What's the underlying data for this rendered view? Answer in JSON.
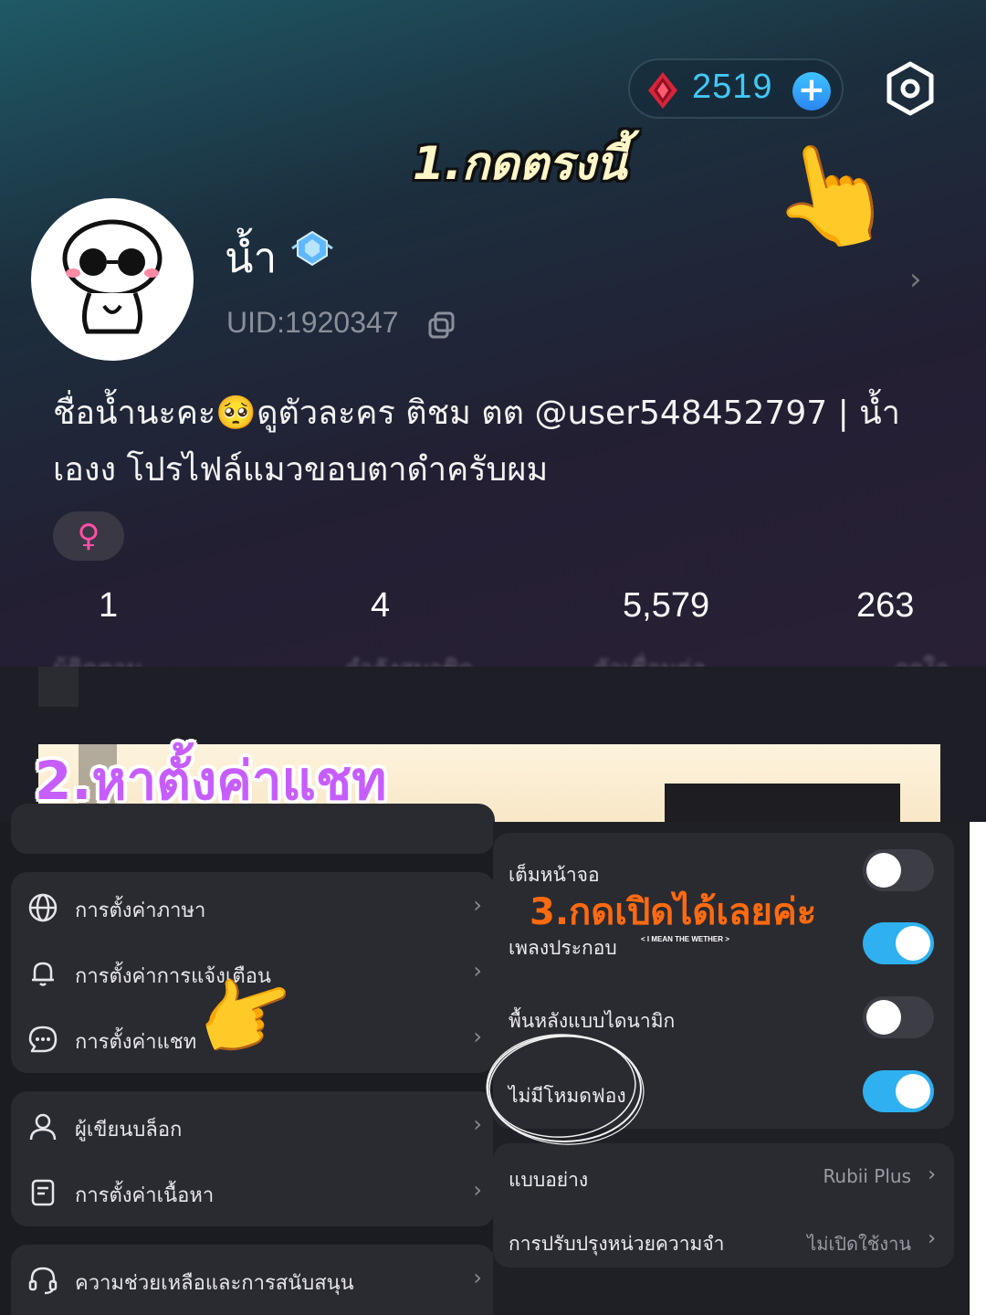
{
  "header": {
    "gem_count": "2519",
    "gem_plus": "+",
    "gem_icon": "diamond-gem-icon",
    "settings_icon": "hexagon-settings-icon"
  },
  "annotations": {
    "step1": "1.กดตรงนี้",
    "step2": "2.หาตั้งค่าแชท",
    "step3": "3.กดเปิดได้เลยค่ะ",
    "tiny_note": "< I MEAN THE WETHER >",
    "hand_emoji": "👉"
  },
  "profile": {
    "name": "น้ำ",
    "uid": "UID:1920347",
    "bio": "ชื่อน้ำนะคะ🥺ดูตัวละคร ติชม ตต @user548452797 | น้ำ เองง โปรไฟล์แมวขอบตาดำครับผม",
    "gender_symbol": "♀",
    "stats": [
      "1",
      "4",
      "5,579",
      "263"
    ],
    "stat_labels": [
      "ผู้ติดตาม",
      "กำลังสมาชิก",
      "ตัวเชื่อมต่อ",
      "ถูกใจ"
    ]
  },
  "left_menu": {
    "card1": [
      {
        "label": "การตั้งค่าภาษา",
        "icon": "globe-icon"
      },
      {
        "label": "การตั้งค่าการแจ้งเตือน",
        "icon": "bell-icon"
      },
      {
        "label": "การตั้งค่าแชท",
        "icon": "chat-bubble-icon"
      }
    ],
    "card2": [
      {
        "label": "ผู้เขียนบล็อก",
        "icon": "person-icon"
      },
      {
        "label": "การตั้งค่าเนื้อหา",
        "icon": "document-icon"
      }
    ],
    "card3": [
      {
        "label": "ความช่วยเหลือและการสนับสนุน",
        "icon": "headset-icon"
      }
    ],
    "chevron": "›"
  },
  "chat_settings": {
    "toggles": [
      {
        "label": "เต็มหน้าจอ",
        "on": false
      },
      {
        "label": "เพลงประกอบ",
        "on": true
      },
      {
        "label": "พื้นหลังแบบไดนามิก",
        "on": false
      },
      {
        "label": "ไม่มีโหมดฟอง",
        "on": true
      }
    ],
    "options": [
      {
        "label": "แบบอย่าง",
        "value": "Rubii Plus"
      },
      {
        "label": "การปรับปรุงหน่วยความจำ",
        "value": "ไม่เปิดใช้งาน"
      }
    ],
    "toggle_on_color": "#2fb0f0",
    "toggle_off_color": "#3d3e45"
  }
}
